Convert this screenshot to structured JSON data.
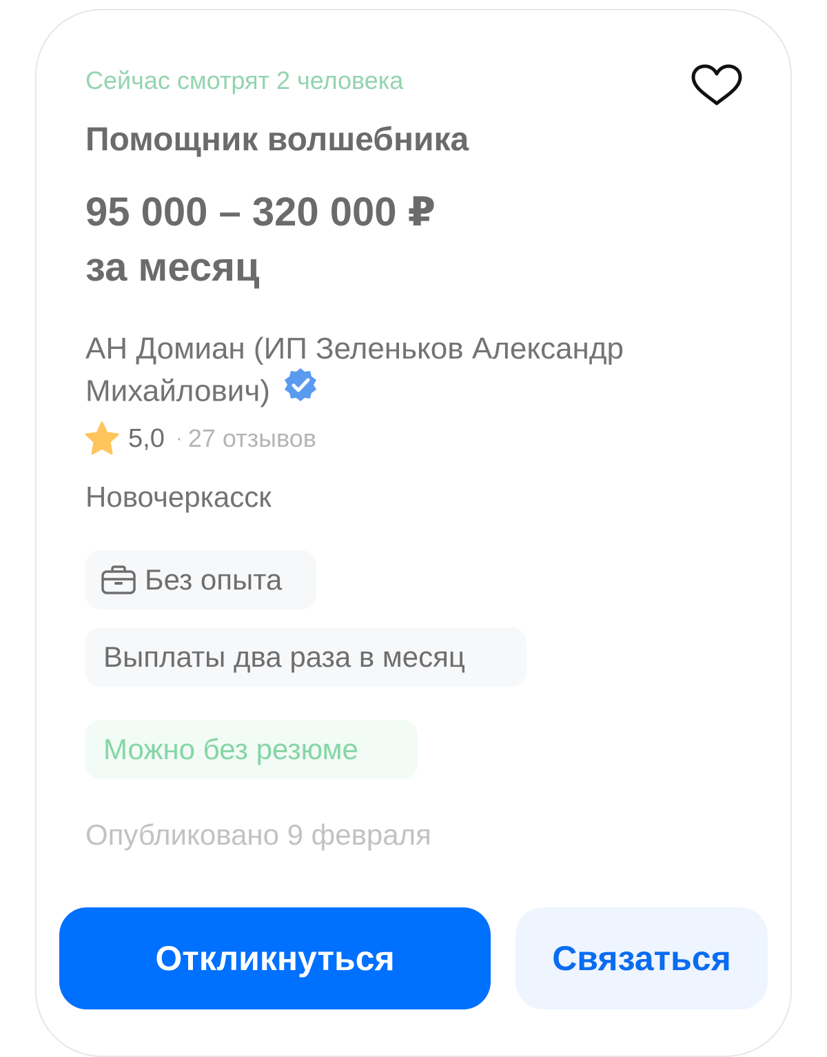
{
  "vacancy": {
    "viewers_text": "Сейчас смотрят 2 человека",
    "title": "Помощник волшебника",
    "salary_range": "95 000 – 320 000 ₽",
    "salary_period": "за месяц",
    "employer_name": "АН Домиан (ИП Зеленьков Александр Михайлович)",
    "rating": "5,0",
    "rating_separator": "·",
    "reviews_text": "27 отзывов",
    "city": "Новочеркасск",
    "tags": {
      "experience": "Без опыта",
      "payments": "Выплаты два раза в месяц",
      "no_resume": "Можно без резюме"
    },
    "published_text": "Опубликовано 9 февраля"
  },
  "actions": {
    "apply_label": "Откликнуться",
    "contact_label": "Связаться"
  },
  "icons": {
    "favorite": "heart-icon",
    "verified": "verified-badge-icon",
    "rating": "star-icon",
    "experience": "briefcase-icon"
  },
  "colors": {
    "primary": "#0070ff",
    "secondary_button_bg": "#eef5ff",
    "secondary_button_text": "#0a6cf0",
    "viewers_green": "#93d4ae",
    "resume_tag_bg": "#f2fbf5",
    "resume_tag_text": "#86d5a6",
    "star": "#ffc45c",
    "verified_badge": "#5a9bf0"
  }
}
